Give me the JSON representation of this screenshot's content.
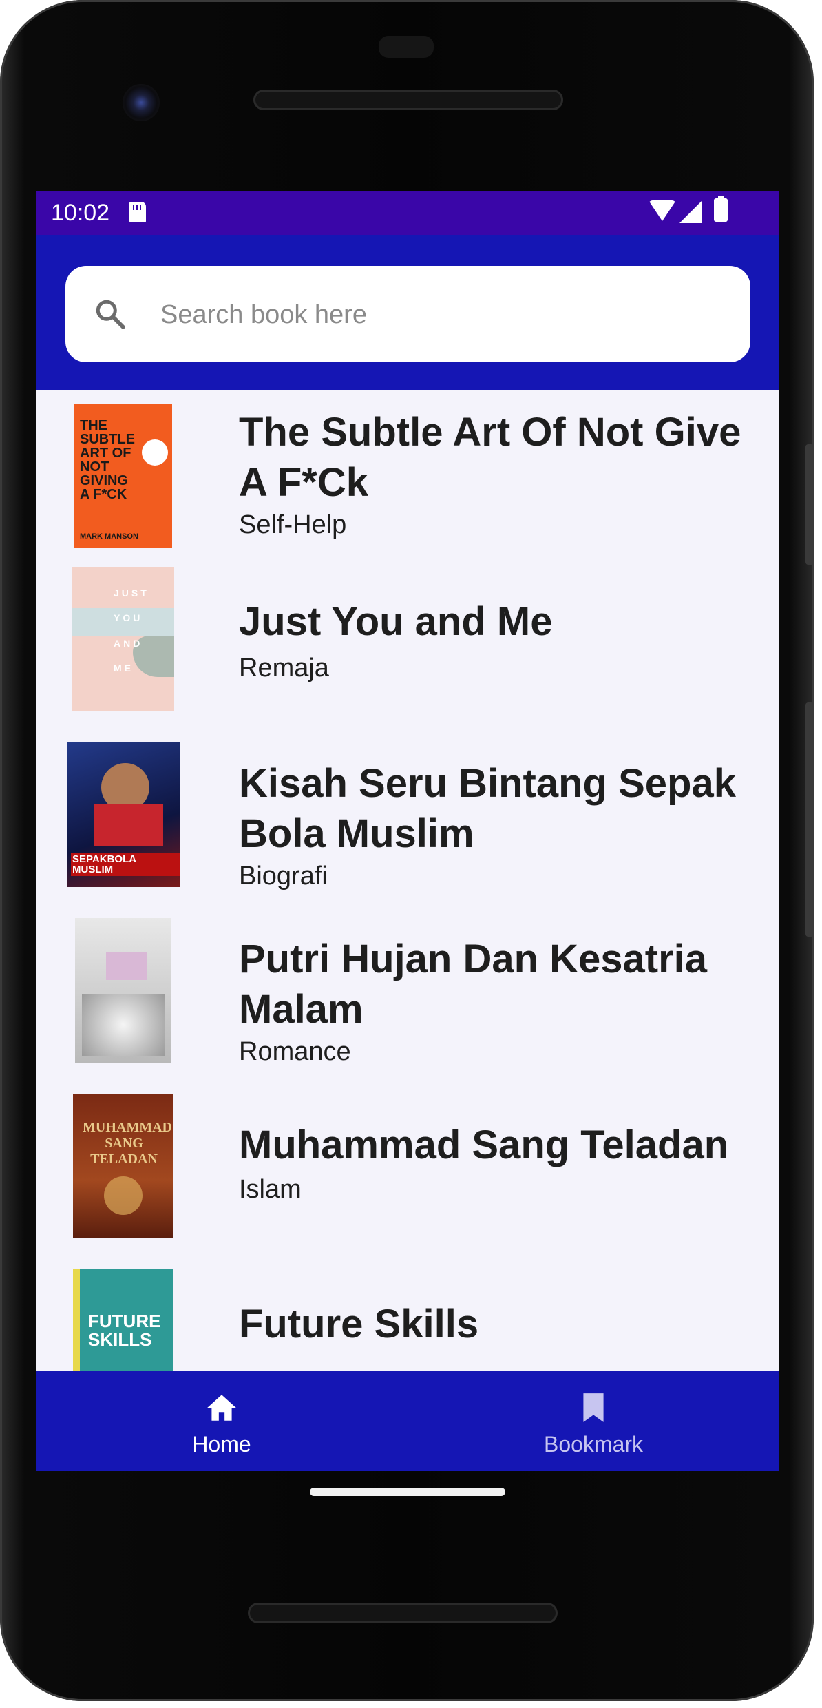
{
  "status_bar": {
    "time": "10:02"
  },
  "search": {
    "placeholder": "Search book here"
  },
  "books": [
    {
      "title": "The Subtle Art Of Not Give A F*Ck",
      "category": "Self-Help",
      "cover": {
        "label": "THE SUBTLE ART OF NOT GIVING A F*CK",
        "author": "MARK MANSON",
        "bg": "#f25c1f"
      }
    },
    {
      "title": "Just You and Me",
      "category": "Remaja",
      "cover": {
        "label": "JUST YOU AND ME",
        "bg": "#f3d2c9"
      }
    },
    {
      "title": "Kisah Seru Bintang Sepak Bola Muslim",
      "category": "Biografi",
      "cover": {
        "label": "SEPAKBOLA MUSLIM",
        "bg": "#1c2a6b"
      }
    },
    {
      "title": "Putri Hujan Dan Kesatria Malam",
      "category": "Romance",
      "cover": {
        "bg": "#cfcfcf"
      }
    },
    {
      "title": "Muhammad Sang Teladan",
      "category": "Islam",
      "cover": {
        "label": "MUHAMMAD SANG TELADAN",
        "bg": "#8a3a1c"
      }
    },
    {
      "title": "Future Skills",
      "category": "",
      "cover": {
        "label": "FUTURE SKILLS",
        "bg": "#2e9a96"
      }
    }
  ],
  "nav": {
    "home": {
      "label": "Home",
      "icon": "home-icon",
      "color": "#ffffff"
    },
    "bookmark": {
      "label": "Bookmark",
      "icon": "bookmark-icon",
      "color": "#c7c5f0"
    }
  },
  "colors": {
    "status_bar": "#3a06a8",
    "app_bar": "#1516b4",
    "list_bg": "#f4f3fb"
  }
}
